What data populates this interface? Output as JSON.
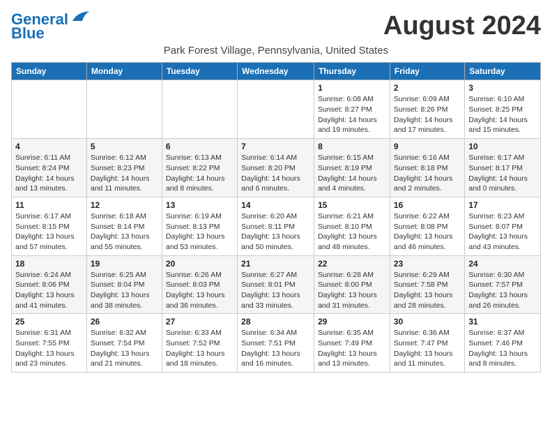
{
  "header": {
    "logo_line1": "General",
    "logo_line2": "Blue",
    "month": "August 2024",
    "location": "Park Forest Village, Pennsylvania, United States"
  },
  "days_of_week": [
    "Sunday",
    "Monday",
    "Tuesday",
    "Wednesday",
    "Thursday",
    "Friday",
    "Saturday"
  ],
  "weeks": [
    [
      {
        "day": "",
        "info": ""
      },
      {
        "day": "",
        "info": ""
      },
      {
        "day": "",
        "info": ""
      },
      {
        "day": "",
        "info": ""
      },
      {
        "day": "1",
        "info": "Sunrise: 6:08 AM\nSunset: 8:27 PM\nDaylight: 14 hours\nand 19 minutes."
      },
      {
        "day": "2",
        "info": "Sunrise: 6:09 AM\nSunset: 8:26 PM\nDaylight: 14 hours\nand 17 minutes."
      },
      {
        "day": "3",
        "info": "Sunrise: 6:10 AM\nSunset: 8:25 PM\nDaylight: 14 hours\nand 15 minutes."
      }
    ],
    [
      {
        "day": "4",
        "info": "Sunrise: 6:11 AM\nSunset: 8:24 PM\nDaylight: 14 hours\nand 13 minutes."
      },
      {
        "day": "5",
        "info": "Sunrise: 6:12 AM\nSunset: 8:23 PM\nDaylight: 14 hours\nand 11 minutes."
      },
      {
        "day": "6",
        "info": "Sunrise: 6:13 AM\nSunset: 8:22 PM\nDaylight: 14 hours\nand 8 minutes."
      },
      {
        "day": "7",
        "info": "Sunrise: 6:14 AM\nSunset: 8:20 PM\nDaylight: 14 hours\nand 6 minutes."
      },
      {
        "day": "8",
        "info": "Sunrise: 6:15 AM\nSunset: 8:19 PM\nDaylight: 14 hours\nand 4 minutes."
      },
      {
        "day": "9",
        "info": "Sunrise: 6:16 AM\nSunset: 8:18 PM\nDaylight: 14 hours\nand 2 minutes."
      },
      {
        "day": "10",
        "info": "Sunrise: 6:17 AM\nSunset: 8:17 PM\nDaylight: 14 hours\nand 0 minutes."
      }
    ],
    [
      {
        "day": "11",
        "info": "Sunrise: 6:17 AM\nSunset: 8:15 PM\nDaylight: 13 hours\nand 57 minutes."
      },
      {
        "day": "12",
        "info": "Sunrise: 6:18 AM\nSunset: 8:14 PM\nDaylight: 13 hours\nand 55 minutes."
      },
      {
        "day": "13",
        "info": "Sunrise: 6:19 AM\nSunset: 8:13 PM\nDaylight: 13 hours\nand 53 minutes."
      },
      {
        "day": "14",
        "info": "Sunrise: 6:20 AM\nSunset: 8:11 PM\nDaylight: 13 hours\nand 50 minutes."
      },
      {
        "day": "15",
        "info": "Sunrise: 6:21 AM\nSunset: 8:10 PM\nDaylight: 13 hours\nand 48 minutes."
      },
      {
        "day": "16",
        "info": "Sunrise: 6:22 AM\nSunset: 8:08 PM\nDaylight: 13 hours\nand 46 minutes."
      },
      {
        "day": "17",
        "info": "Sunrise: 6:23 AM\nSunset: 8:07 PM\nDaylight: 13 hours\nand 43 minutes."
      }
    ],
    [
      {
        "day": "18",
        "info": "Sunrise: 6:24 AM\nSunset: 8:06 PM\nDaylight: 13 hours\nand 41 minutes."
      },
      {
        "day": "19",
        "info": "Sunrise: 6:25 AM\nSunset: 8:04 PM\nDaylight: 13 hours\nand 38 minutes."
      },
      {
        "day": "20",
        "info": "Sunrise: 6:26 AM\nSunset: 8:03 PM\nDaylight: 13 hours\nand 36 minutes."
      },
      {
        "day": "21",
        "info": "Sunrise: 6:27 AM\nSunset: 8:01 PM\nDaylight: 13 hours\nand 33 minutes."
      },
      {
        "day": "22",
        "info": "Sunrise: 6:28 AM\nSunset: 8:00 PM\nDaylight: 13 hours\nand 31 minutes."
      },
      {
        "day": "23",
        "info": "Sunrise: 6:29 AM\nSunset: 7:58 PM\nDaylight: 13 hours\nand 28 minutes."
      },
      {
        "day": "24",
        "info": "Sunrise: 6:30 AM\nSunset: 7:57 PM\nDaylight: 13 hours\nand 26 minutes."
      }
    ],
    [
      {
        "day": "25",
        "info": "Sunrise: 6:31 AM\nSunset: 7:55 PM\nDaylight: 13 hours\nand 23 minutes."
      },
      {
        "day": "26",
        "info": "Sunrise: 6:32 AM\nSunset: 7:54 PM\nDaylight: 13 hours\nand 21 minutes."
      },
      {
        "day": "27",
        "info": "Sunrise: 6:33 AM\nSunset: 7:52 PM\nDaylight: 13 hours\nand 18 minutes."
      },
      {
        "day": "28",
        "info": "Sunrise: 6:34 AM\nSunset: 7:51 PM\nDaylight: 13 hours\nand 16 minutes."
      },
      {
        "day": "29",
        "info": "Sunrise: 6:35 AM\nSunset: 7:49 PM\nDaylight: 13 hours\nand 13 minutes."
      },
      {
        "day": "30",
        "info": "Sunrise: 6:36 AM\nSunset: 7:47 PM\nDaylight: 13 hours\nand 11 minutes."
      },
      {
        "day": "31",
        "info": "Sunrise: 6:37 AM\nSunset: 7:46 PM\nDaylight: 13 hours\nand 8 minutes."
      }
    ]
  ]
}
